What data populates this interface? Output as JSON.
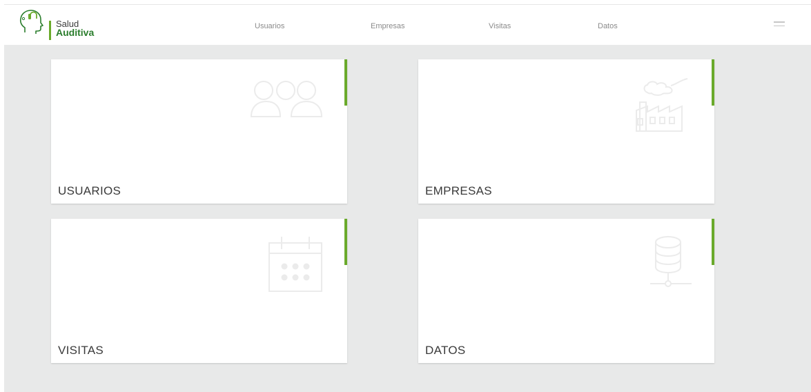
{
  "brand": {
    "line1": "Salud",
    "line2": "Auditiva"
  },
  "nav": [
    {
      "label": "Usuarios"
    },
    {
      "label": "Empresas"
    },
    {
      "label": "Visitas"
    },
    {
      "label": "Datos"
    }
  ],
  "cards": [
    {
      "title": "USUARIOS",
      "icon": "users-icon"
    },
    {
      "title": "EMPRESAS",
      "icon": "factory-icon"
    },
    {
      "title": "VISITAS",
      "icon": "calendar-icon"
    },
    {
      "title": "DATOS",
      "icon": "database-icon"
    }
  ],
  "colors": {
    "accent": "#6aaa2b",
    "brand_text": "#2a7d2c",
    "background": "#e8e9e9",
    "icon": "#ebebeb"
  }
}
